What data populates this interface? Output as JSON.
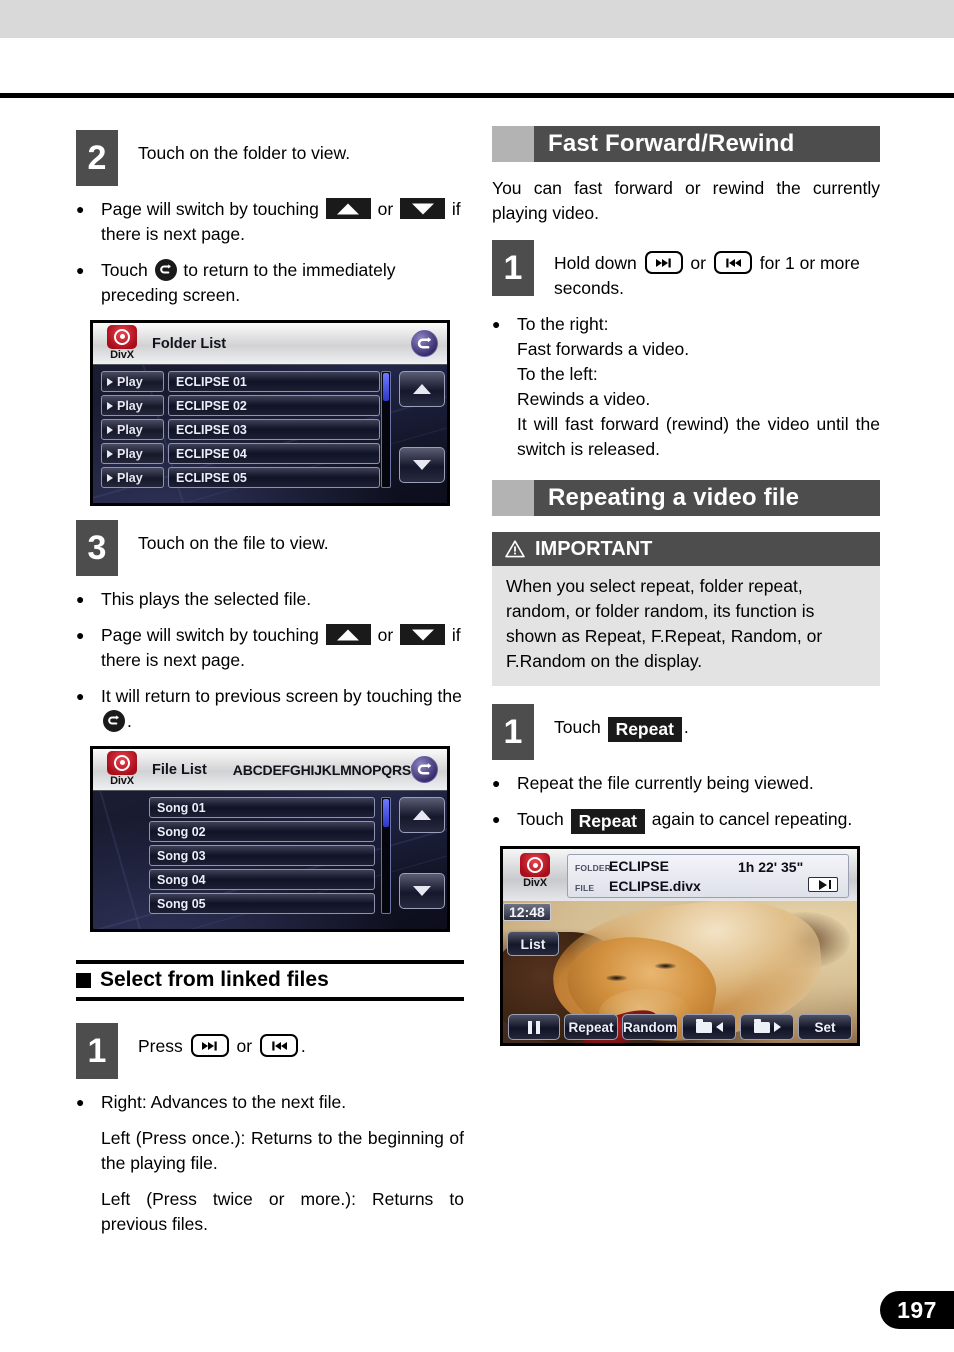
{
  "page": {
    "number": "197"
  },
  "left_column": {
    "step2": {
      "number": "2",
      "text": "Touch on the folder to view."
    },
    "bullets_after_step2": [
      {
        "pre": "Page will switch by touching ",
        "mid": " or ",
        "post": " if there is next page."
      },
      {
        "pre": "Touch ",
        "post": " to return to the immediately preceding screen."
      }
    ],
    "folder_list_screen": {
      "logo_text": "DivX",
      "title": "Folder List",
      "rows": [
        {
          "play_label": "Play",
          "name": "ECLIPSE 01"
        },
        {
          "play_label": "Play",
          "name": "ECLIPSE 02"
        },
        {
          "play_label": "Play",
          "name": "ECLIPSE 03"
        },
        {
          "play_label": "Play",
          "name": "ECLIPSE 04"
        },
        {
          "play_label": "Play",
          "name": "ECLIPSE 05"
        }
      ]
    },
    "step3": {
      "number": "3",
      "text": "Touch on the file to view."
    },
    "bullets_after_step3": [
      {
        "text": "This plays the selected file."
      },
      {
        "pre": "Page will switch by touching ",
        "mid": " or ",
        "post": " if there is next page."
      },
      {
        "pre": "It will return to previous screen by touching the ",
        "post": "."
      }
    ],
    "file_list_screen": {
      "logo_text": "DivX",
      "title": "File List",
      "subtitle": "ABCDEFGHIJKLMNOPQRST",
      "rows": [
        {
          "name": "Song 01"
        },
        {
          "name": "Song 02"
        },
        {
          "name": "Song 03"
        },
        {
          "name": "Song 04"
        },
        {
          "name": "Song 05"
        }
      ]
    },
    "subsection": {
      "title": "Select from linked files"
    },
    "step1_linked": {
      "number": "1",
      "pre": "Press ",
      "mid": " or ",
      "post": "."
    },
    "bullets_after_step1_linked": [
      {
        "text": "Right: Advances to the next file."
      },
      {
        "text": "Left (Press once.): Returns to the beginning of the playing file."
      },
      {
        "text": "Left (Press twice or more.): Returns to previous files."
      }
    ]
  },
  "right_column": {
    "section_ff": {
      "title": "Fast Forward/Rewind",
      "intro": "You can fast forward or rewind the currently playing video.",
      "step1": {
        "number": "1",
        "pre": "Hold down ",
        "mid": " or ",
        "post": " for 1 or more seconds."
      },
      "bullet_lines": [
        "To the right:",
        "Fast forwards a video.",
        "To the left:",
        "Rewinds a video.",
        "It will fast forward (rewind) the video until the switch is released."
      ]
    },
    "section_repeat": {
      "title": "Repeating a video file",
      "important": {
        "heading": "IMPORTANT",
        "body": "When you select repeat, folder repeat, random, or folder random, its function is shown as Repeat, F.Repeat, Random, or F.Random on the display."
      },
      "step1": {
        "number": "1",
        "pre": "Touch ",
        "key": "Repeat",
        "post": "."
      },
      "bullets": [
        {
          "text": "Repeat the file currently being viewed."
        },
        {
          "pre": "Touch ",
          "key": "Repeat",
          "post": " again to cancel repeating."
        }
      ],
      "playback_screen": {
        "logo_text": "DivX",
        "folder_key": "FOLDER",
        "folder_value": "ECLIPSE",
        "file_key": "FILE",
        "file_value": "ECLIPSE.divx",
        "duration": "1h 22' 35\"",
        "clock": "12:48",
        "list_button": "List",
        "controls": [
          "Repeat",
          "Random",
          "Set"
        ]
      }
    }
  }
}
